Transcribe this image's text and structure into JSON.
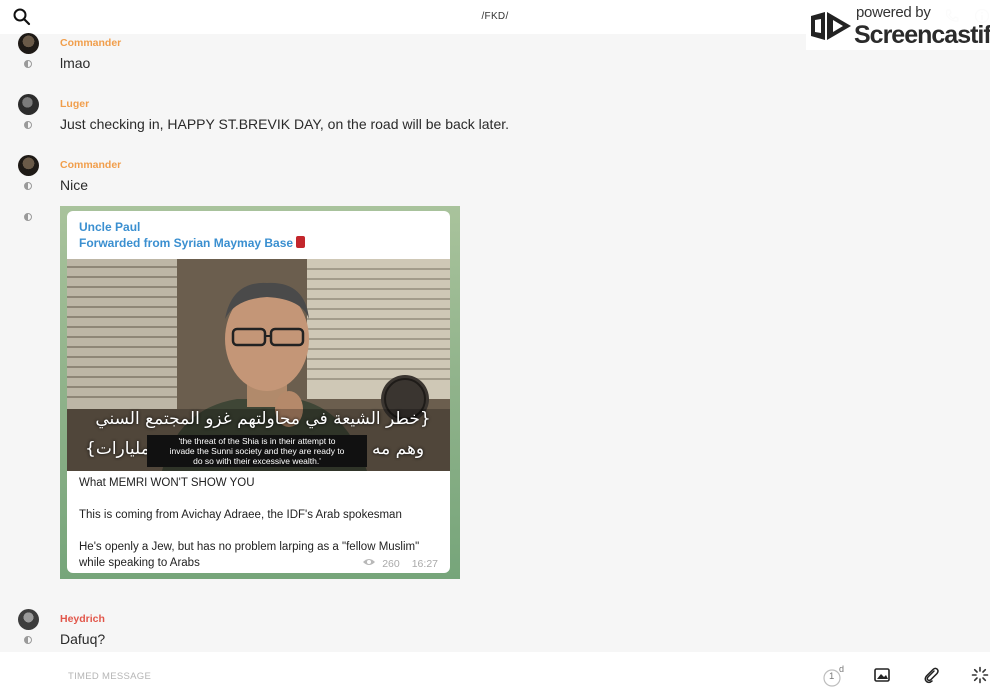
{
  "header": {
    "title": "/FKD/"
  },
  "watermark": {
    "line1": "powered by",
    "line2": "Screencastify"
  },
  "messages": [
    {
      "sender": "Commander",
      "text": "lmao"
    },
    {
      "sender": "Luger",
      "text": "Just checking in, HAPPY ST.BREVIK DAY, on the road will be back later."
    },
    {
      "sender": "Commander",
      "text": "Nice"
    },
    {
      "sender": "Heydrich",
      "text": "Dafuq?"
    }
  ],
  "forward": {
    "author": "Uncle Paul",
    "forwarded_from": "Forwarded from Syrian Maymay Base",
    "video": {
      "arabic_line1": "{خطر الشيعة في محاولتهم غزو المجتمع السني",
      "arabic_line2_left": "وهم مه",
      "arabic_line2_right": "المليارات}",
      "subtitle_en": [
        "'the threat of the Shia is in their attempt to",
        "invade the Sunni society and they are ready to",
        "do so with their excessive wealth.'"
      ]
    },
    "caption": [
      "What MEMRI WON'T SHOW YOU",
      "This is coming from Avichay Adraee, the IDF's Arab spokesman",
      "He's openly a Jew, but has no problem larping as a \"fellow Muslim\"",
      "while speaking to Arabs"
    ],
    "views": "260",
    "time": "16:27"
  },
  "composer": {
    "placeholder": "TIMED MESSAGE",
    "timer_value": "1",
    "timer_unit": "d"
  },
  "colors": {
    "sender_orange": "#f19e4b",
    "sender_red": "#e2564a",
    "link_blue": "#3a8fd0"
  }
}
